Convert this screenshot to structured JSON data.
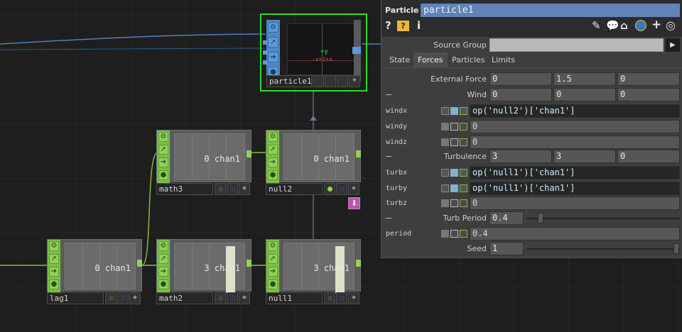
{
  "nodes": {
    "particle1": {
      "name": "particle1"
    },
    "math3": {
      "name": "math3",
      "label": "0 chan1"
    },
    "null2": {
      "name": "null2",
      "label": "0 chan1"
    },
    "lag1": {
      "name": "lag1",
      "label": "0 chan1"
    },
    "math2": {
      "name": "math2",
      "label": "3 chan1"
    },
    "null1": {
      "name": "null1",
      "label": "3 chan1"
    }
  },
  "viewer": {
    "axis_y": "+y",
    "axis_x": "-x+z+x"
  },
  "panel": {
    "type": "Particle",
    "name": "particle1",
    "icons": [
      "help-icon",
      "python-help-icon",
      "info-icon",
      "edit-icon",
      "comment-icon",
      "tag-icon",
      "python-icon",
      "add-icon",
      "target-icon"
    ],
    "source_group": {
      "label": "Source Group",
      "value": ""
    },
    "tabs": [
      "State",
      "Forces",
      "Particles",
      "Limits"
    ],
    "active_tab": "Forces",
    "external_force": {
      "label": "External Force",
      "values": [
        "0",
        "1.5",
        "0"
      ]
    },
    "wind": {
      "label": "Wind",
      "values": [
        "0",
        "0",
        "0"
      ]
    },
    "windx": {
      "label": "windx",
      "value": "op('null2')['chan1']"
    },
    "windy": {
      "label": "windy",
      "value": "0"
    },
    "windz": {
      "label": "windz",
      "value": "0"
    },
    "turbulence": {
      "label": "Turbulence",
      "values": [
        "3",
        "3",
        "0"
      ]
    },
    "turbx": {
      "label": "turbx",
      "value": "op('null1')['chan1']"
    },
    "turby": {
      "label": "turby",
      "value": "op('null1')['chan1']"
    },
    "turbz": {
      "label": "turbz",
      "value": "0"
    },
    "turb_period": {
      "label": "Turb Period",
      "value": "0.4"
    },
    "period": {
      "label": "period",
      "value": "0.4"
    },
    "seed": {
      "label": "Seed",
      "value": "1"
    }
  },
  "colors": {
    "chop_green": "#7bbf46",
    "sop_blue": "#4f86c6",
    "selected": "#2cdc2c",
    "expression": "#c9ecff"
  }
}
